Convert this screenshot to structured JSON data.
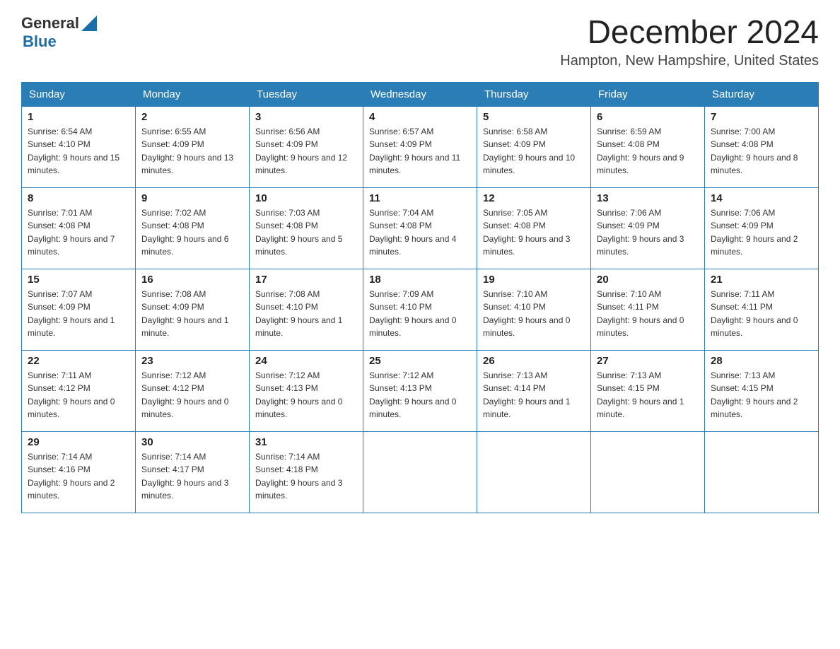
{
  "header": {
    "logo_general": "General",
    "logo_blue": "Blue",
    "month_title": "December 2024",
    "location": "Hampton, New Hampshire, United States"
  },
  "weekdays": [
    "Sunday",
    "Monday",
    "Tuesday",
    "Wednesday",
    "Thursday",
    "Friday",
    "Saturday"
  ],
  "weeks": [
    [
      {
        "day": "1",
        "sunrise": "6:54 AM",
        "sunset": "4:10 PM",
        "daylight": "9 hours and 15 minutes."
      },
      {
        "day": "2",
        "sunrise": "6:55 AM",
        "sunset": "4:09 PM",
        "daylight": "9 hours and 13 minutes."
      },
      {
        "day": "3",
        "sunrise": "6:56 AM",
        "sunset": "4:09 PM",
        "daylight": "9 hours and 12 minutes."
      },
      {
        "day": "4",
        "sunrise": "6:57 AM",
        "sunset": "4:09 PM",
        "daylight": "9 hours and 11 minutes."
      },
      {
        "day": "5",
        "sunrise": "6:58 AM",
        "sunset": "4:09 PM",
        "daylight": "9 hours and 10 minutes."
      },
      {
        "day": "6",
        "sunrise": "6:59 AM",
        "sunset": "4:08 PM",
        "daylight": "9 hours and 9 minutes."
      },
      {
        "day": "7",
        "sunrise": "7:00 AM",
        "sunset": "4:08 PM",
        "daylight": "9 hours and 8 minutes."
      }
    ],
    [
      {
        "day": "8",
        "sunrise": "7:01 AM",
        "sunset": "4:08 PM",
        "daylight": "9 hours and 7 minutes."
      },
      {
        "day": "9",
        "sunrise": "7:02 AM",
        "sunset": "4:08 PM",
        "daylight": "9 hours and 6 minutes."
      },
      {
        "day": "10",
        "sunrise": "7:03 AM",
        "sunset": "4:08 PM",
        "daylight": "9 hours and 5 minutes."
      },
      {
        "day": "11",
        "sunrise": "7:04 AM",
        "sunset": "4:08 PM",
        "daylight": "9 hours and 4 minutes."
      },
      {
        "day": "12",
        "sunrise": "7:05 AM",
        "sunset": "4:08 PM",
        "daylight": "9 hours and 3 minutes."
      },
      {
        "day": "13",
        "sunrise": "7:06 AM",
        "sunset": "4:09 PM",
        "daylight": "9 hours and 3 minutes."
      },
      {
        "day": "14",
        "sunrise": "7:06 AM",
        "sunset": "4:09 PM",
        "daylight": "9 hours and 2 minutes."
      }
    ],
    [
      {
        "day": "15",
        "sunrise": "7:07 AM",
        "sunset": "4:09 PM",
        "daylight": "9 hours and 1 minute."
      },
      {
        "day": "16",
        "sunrise": "7:08 AM",
        "sunset": "4:09 PM",
        "daylight": "9 hours and 1 minute."
      },
      {
        "day": "17",
        "sunrise": "7:08 AM",
        "sunset": "4:10 PM",
        "daylight": "9 hours and 1 minute."
      },
      {
        "day": "18",
        "sunrise": "7:09 AM",
        "sunset": "4:10 PM",
        "daylight": "9 hours and 0 minutes."
      },
      {
        "day": "19",
        "sunrise": "7:10 AM",
        "sunset": "4:10 PM",
        "daylight": "9 hours and 0 minutes."
      },
      {
        "day": "20",
        "sunrise": "7:10 AM",
        "sunset": "4:11 PM",
        "daylight": "9 hours and 0 minutes."
      },
      {
        "day": "21",
        "sunrise": "7:11 AM",
        "sunset": "4:11 PM",
        "daylight": "9 hours and 0 minutes."
      }
    ],
    [
      {
        "day": "22",
        "sunrise": "7:11 AM",
        "sunset": "4:12 PM",
        "daylight": "9 hours and 0 minutes."
      },
      {
        "day": "23",
        "sunrise": "7:12 AM",
        "sunset": "4:12 PM",
        "daylight": "9 hours and 0 minutes."
      },
      {
        "day": "24",
        "sunrise": "7:12 AM",
        "sunset": "4:13 PM",
        "daylight": "9 hours and 0 minutes."
      },
      {
        "day": "25",
        "sunrise": "7:12 AM",
        "sunset": "4:13 PM",
        "daylight": "9 hours and 0 minutes."
      },
      {
        "day": "26",
        "sunrise": "7:13 AM",
        "sunset": "4:14 PM",
        "daylight": "9 hours and 1 minute."
      },
      {
        "day": "27",
        "sunrise": "7:13 AM",
        "sunset": "4:15 PM",
        "daylight": "9 hours and 1 minute."
      },
      {
        "day": "28",
        "sunrise": "7:13 AM",
        "sunset": "4:15 PM",
        "daylight": "9 hours and 2 minutes."
      }
    ],
    [
      {
        "day": "29",
        "sunrise": "7:14 AM",
        "sunset": "4:16 PM",
        "daylight": "9 hours and 2 minutes."
      },
      {
        "day": "30",
        "sunrise": "7:14 AM",
        "sunset": "4:17 PM",
        "daylight": "9 hours and 3 minutes."
      },
      {
        "day": "31",
        "sunrise": "7:14 AM",
        "sunset": "4:18 PM",
        "daylight": "9 hours and 3 minutes."
      },
      null,
      null,
      null,
      null
    ]
  ]
}
